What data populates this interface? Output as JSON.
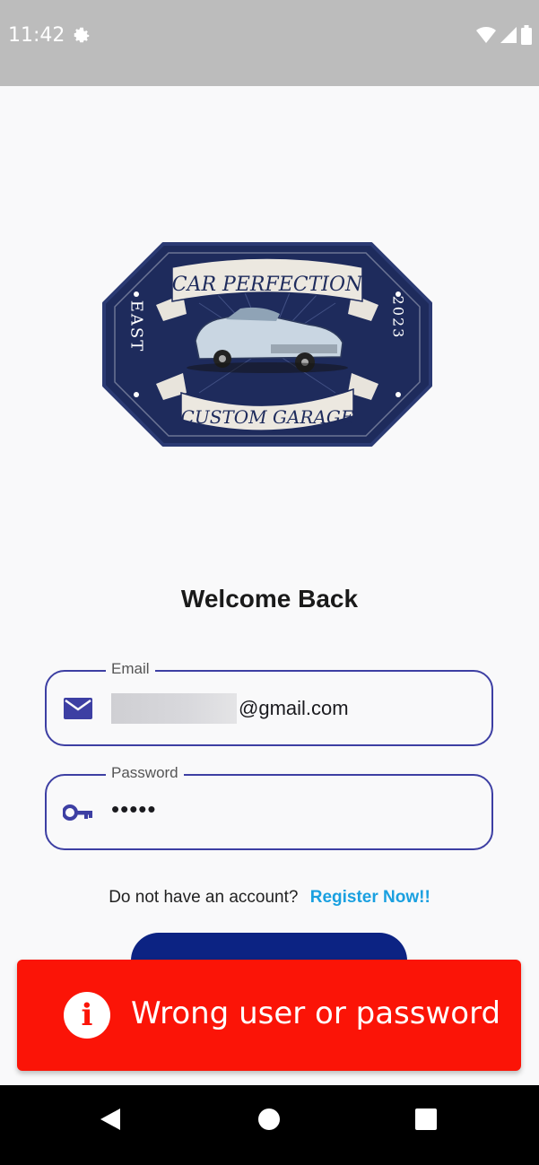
{
  "status_bar": {
    "time": "11:42"
  },
  "logo": {
    "top_text": "CAR PERFECTION",
    "bottom_text": "CUSTOM GARAGE",
    "left_text": "EAST",
    "right_text": "2023"
  },
  "welcome": "Welcome Back",
  "email": {
    "label": "Email",
    "value_visible": "@gmail.com"
  },
  "password": {
    "label": "Password",
    "value_masked": "•••••"
  },
  "register": {
    "question": "Do not have an account?",
    "link": "Register Now!!"
  },
  "toast": {
    "message": "Wrong user or password",
    "icon": "info-icon"
  },
  "colors": {
    "accent": "#3d3fa3",
    "button": "#0c2383",
    "toast": "#fb1407",
    "link": "#1aa0e0"
  }
}
